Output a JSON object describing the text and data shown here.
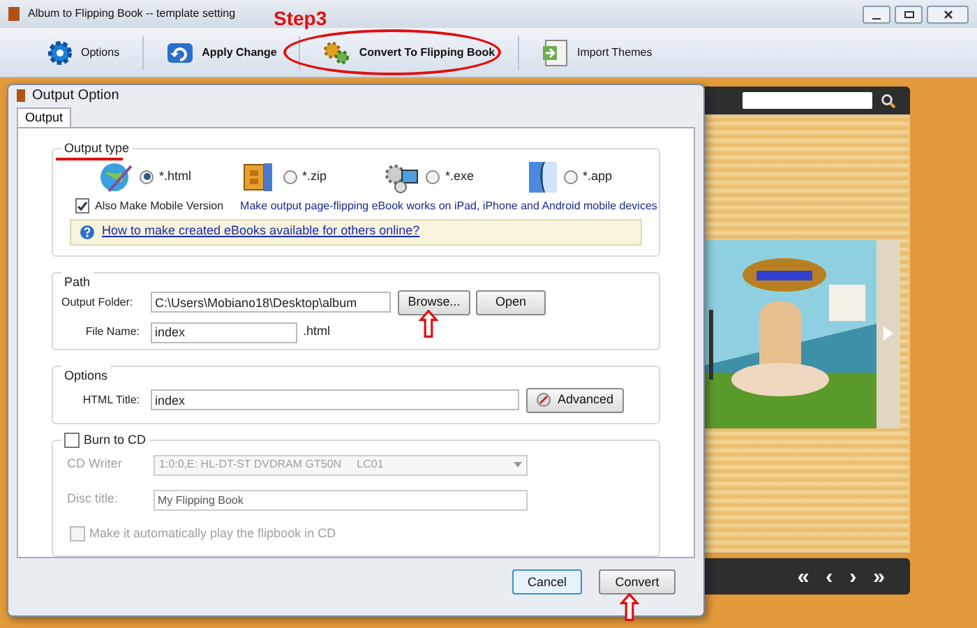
{
  "window": {
    "title": "Album to Flipping Book -- template setting"
  },
  "toolbar": [
    {
      "label": "Options",
      "bold": false
    },
    {
      "label": "Apply Change",
      "bold": true
    },
    {
      "label": "Convert To Flipping Book",
      "bold": true
    },
    {
      "label": "Import Themes",
      "bold": false
    }
  ],
  "annotation": {
    "step_label": "Step3"
  },
  "preview": {
    "nav": [
      "«",
      "‹",
      "›",
      "»"
    ]
  },
  "dialog": {
    "title": "Output Option",
    "tabs": [
      {
        "label": "Output",
        "selected": true
      }
    ],
    "output_type": {
      "legend": "Output type",
      "formats": [
        {
          "label": "*.html",
          "selected": true
        },
        {
          "label": "*.zip",
          "selected": false
        },
        {
          "label": "*.exe",
          "selected": false
        },
        {
          "label": "*.app",
          "selected": false
        }
      ],
      "mobile": {
        "label": "Also Make Mobile Version",
        "checked": true
      },
      "mobile_note": "Make output page-flipping eBook works on iPad, iPhone and Android mobile devices",
      "help_link": "How to make created eBooks available for others online?"
    },
    "path": {
      "legend": "Path",
      "output_folder": {
        "label": "Output Folder:",
        "value": "C:\\Users\\Mobiano18\\Desktop\\album"
      },
      "browse": "Browse...",
      "open": "Open",
      "file_name": {
        "label": "File Name:",
        "value": "index",
        "suffix": ".html"
      }
    },
    "options": {
      "legend": "Options",
      "html_title": {
        "label": "HTML Title:",
        "value": "index"
      },
      "advanced": "Advanced"
    },
    "burn": {
      "label": "Burn to CD",
      "checked": false,
      "cd_writer": {
        "label": "CD Writer",
        "value": "1:0:0,E: HL-DT-ST DVDRAM GT50N     LC01"
      },
      "disc_title": {
        "label": "Disc title:",
        "value": "My Flipping Book"
      },
      "autoplay": {
        "label": "Make it automatically play the flipbook in CD",
        "checked": false
      }
    },
    "buttons": {
      "cancel": "Cancel",
      "convert": "Convert"
    }
  }
}
